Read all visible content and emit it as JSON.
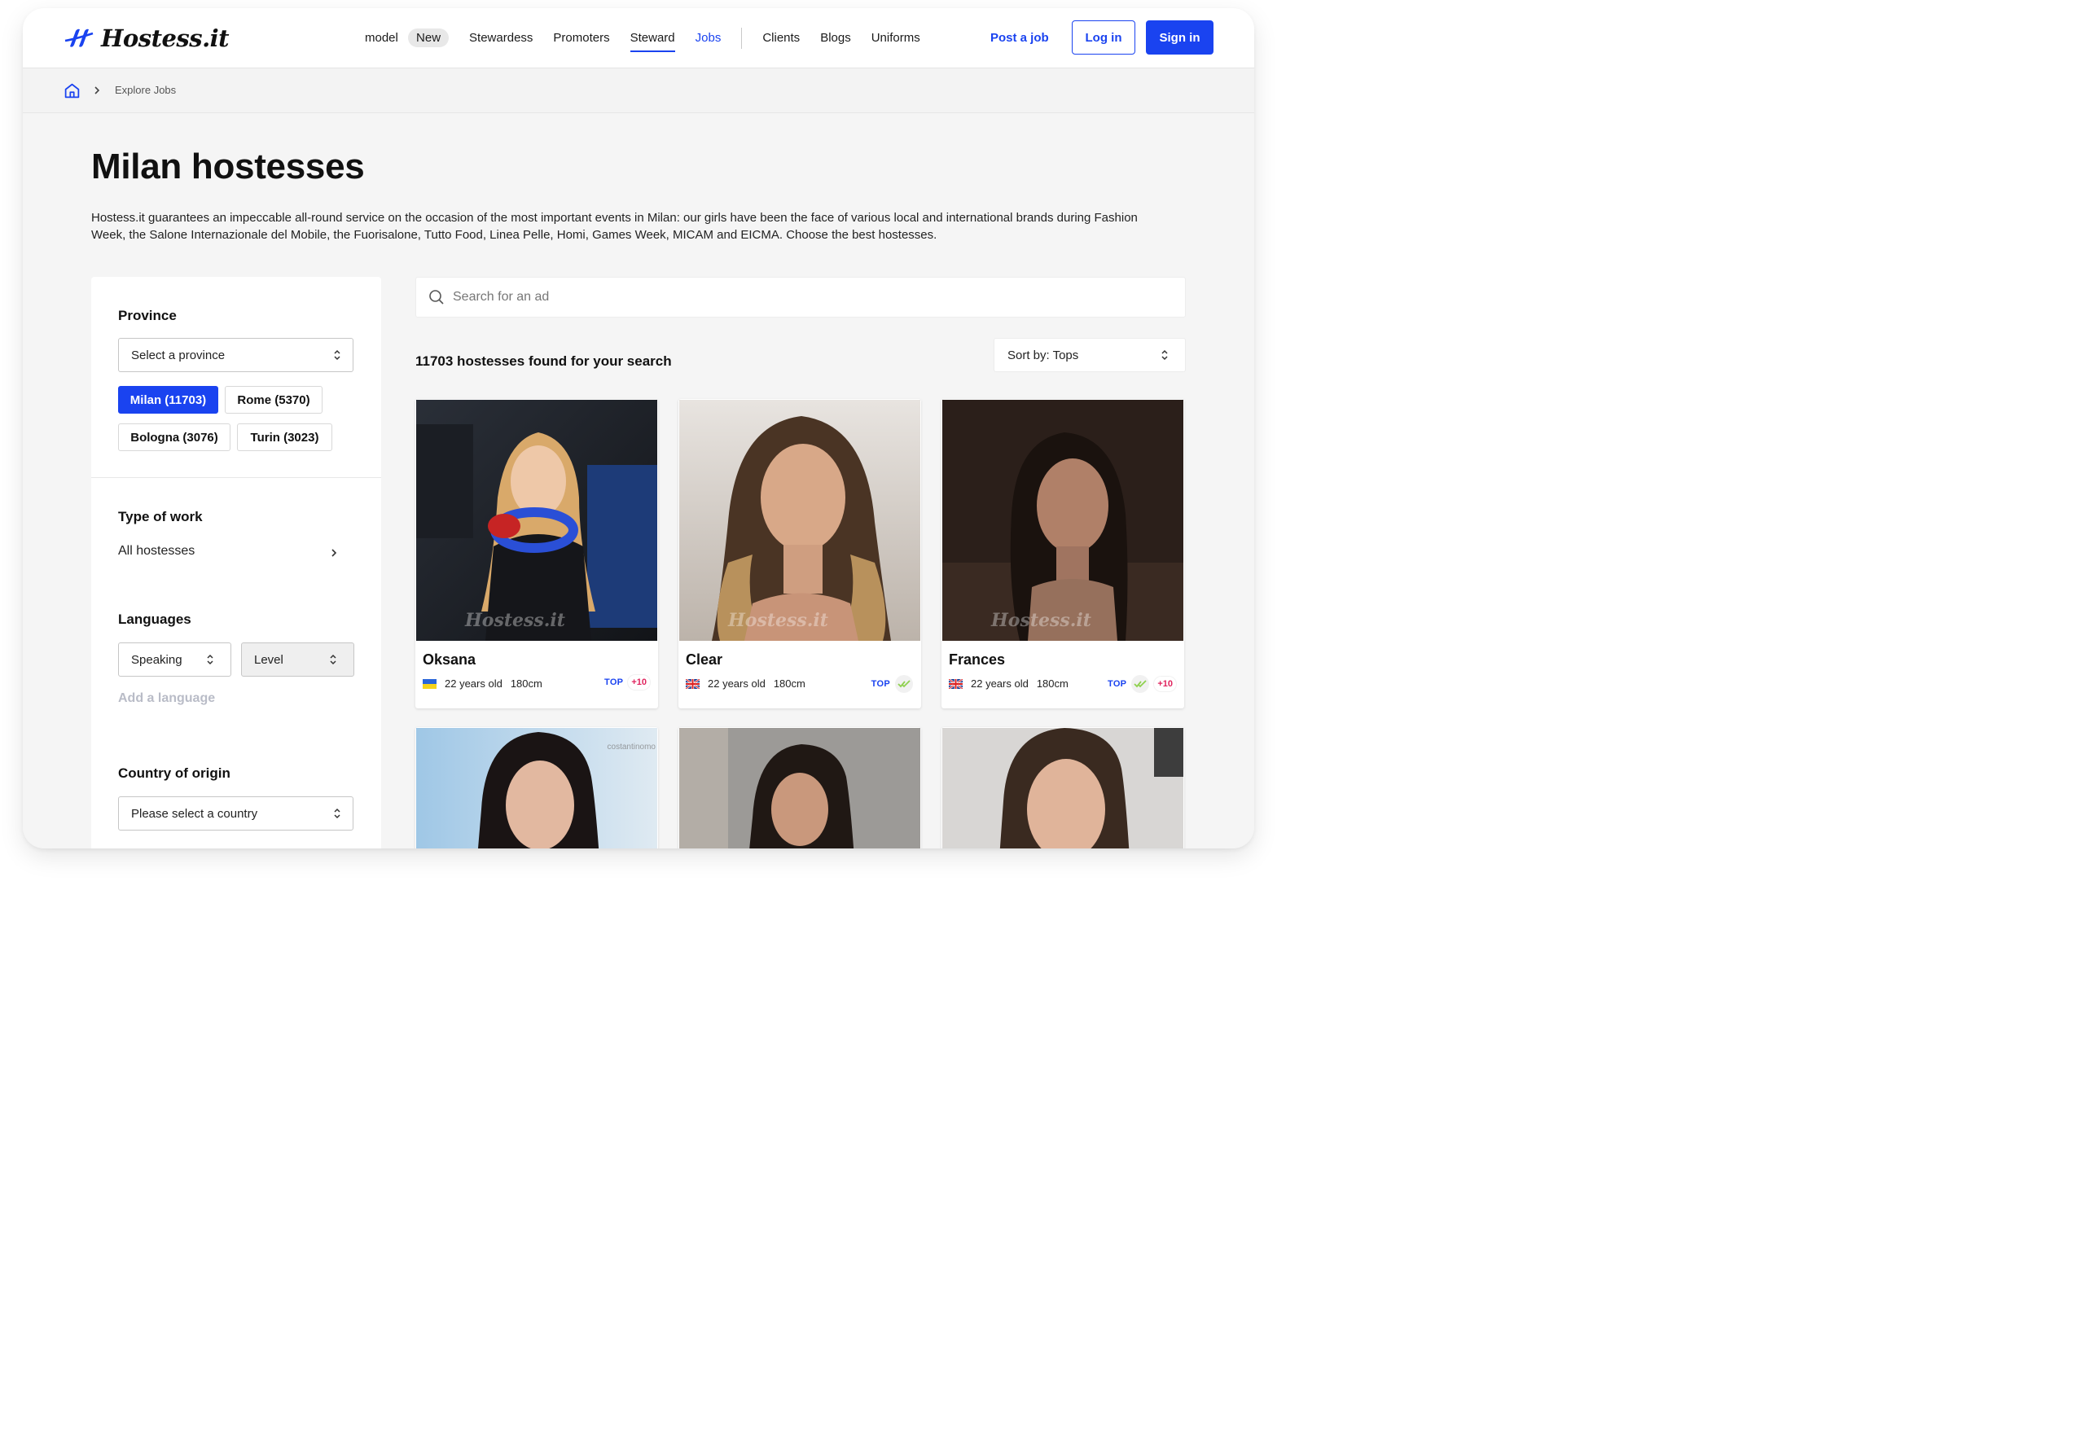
{
  "header": {
    "logo_text": "Hostess.it",
    "nav": {
      "model": "model",
      "new_badge": "New",
      "stewardess": "Stewardess",
      "promoters": "Promoters",
      "steward": "Steward",
      "jobs": "Jobs",
      "clients": "Clients",
      "blogs": "Blogs",
      "uniforms": "Uniforms"
    },
    "post_job": "Post a job",
    "login": "Log in",
    "signin": "Sign in"
  },
  "breadcrumb": {
    "current": "Explore Jobs"
  },
  "page": {
    "title": "Milan hostesses",
    "intro": "Hostess.it guarantees an impeccable all-round service on the occasion of the most important events in Milan: our girls have been the face of various local and international brands during Fashion Week, the Salone Internazionale del Mobile, the Fuorisalone, Tutto Food, Linea Pelle, Homi, Games Week, MICAM and EICMA. Choose the best hostesses."
  },
  "sidebar": {
    "province": {
      "title": "Province",
      "select_placeholder": "Select a province",
      "chips": [
        "Milan (11703)",
        "Rome (5370)",
        "Bologna (3076)",
        "Turin (3023)"
      ]
    },
    "type_of_work": {
      "title": "Type of work",
      "value": "All hostesses"
    },
    "languages": {
      "title": "Languages",
      "speaking": "Speaking",
      "level": "Level",
      "add": "Add a language"
    },
    "country": {
      "title": "Country of origin",
      "placeholder": "Please select a country"
    }
  },
  "results": {
    "search_placeholder": "Search for an ad",
    "count_text": "11703 hostesses found for your search",
    "sort": "Sort by: Tops",
    "cards": [
      {
        "name": "Oksana",
        "age": "22 years old",
        "height": "180cm",
        "top": "TOP",
        "plus": "+10",
        "flag": "ua",
        "checked": false,
        "watermark": "Hostess.it"
      },
      {
        "name": "Clear",
        "age": "22 years old",
        "height": "180cm",
        "top": "TOP",
        "plus": "",
        "flag": "uk",
        "checked": true,
        "watermark": "Hostess.it"
      },
      {
        "name": "Frances",
        "age": "22 years old",
        "height": "180cm",
        "top": "TOP",
        "plus": "+10",
        "flag": "uk",
        "checked": true,
        "watermark": "Hostess.it"
      }
    ],
    "second_row_watermark": "costantinomo"
  },
  "colors": {
    "accent": "#1a43f0",
    "plus_badge": "#e0245e",
    "check": "#8fd14f"
  }
}
